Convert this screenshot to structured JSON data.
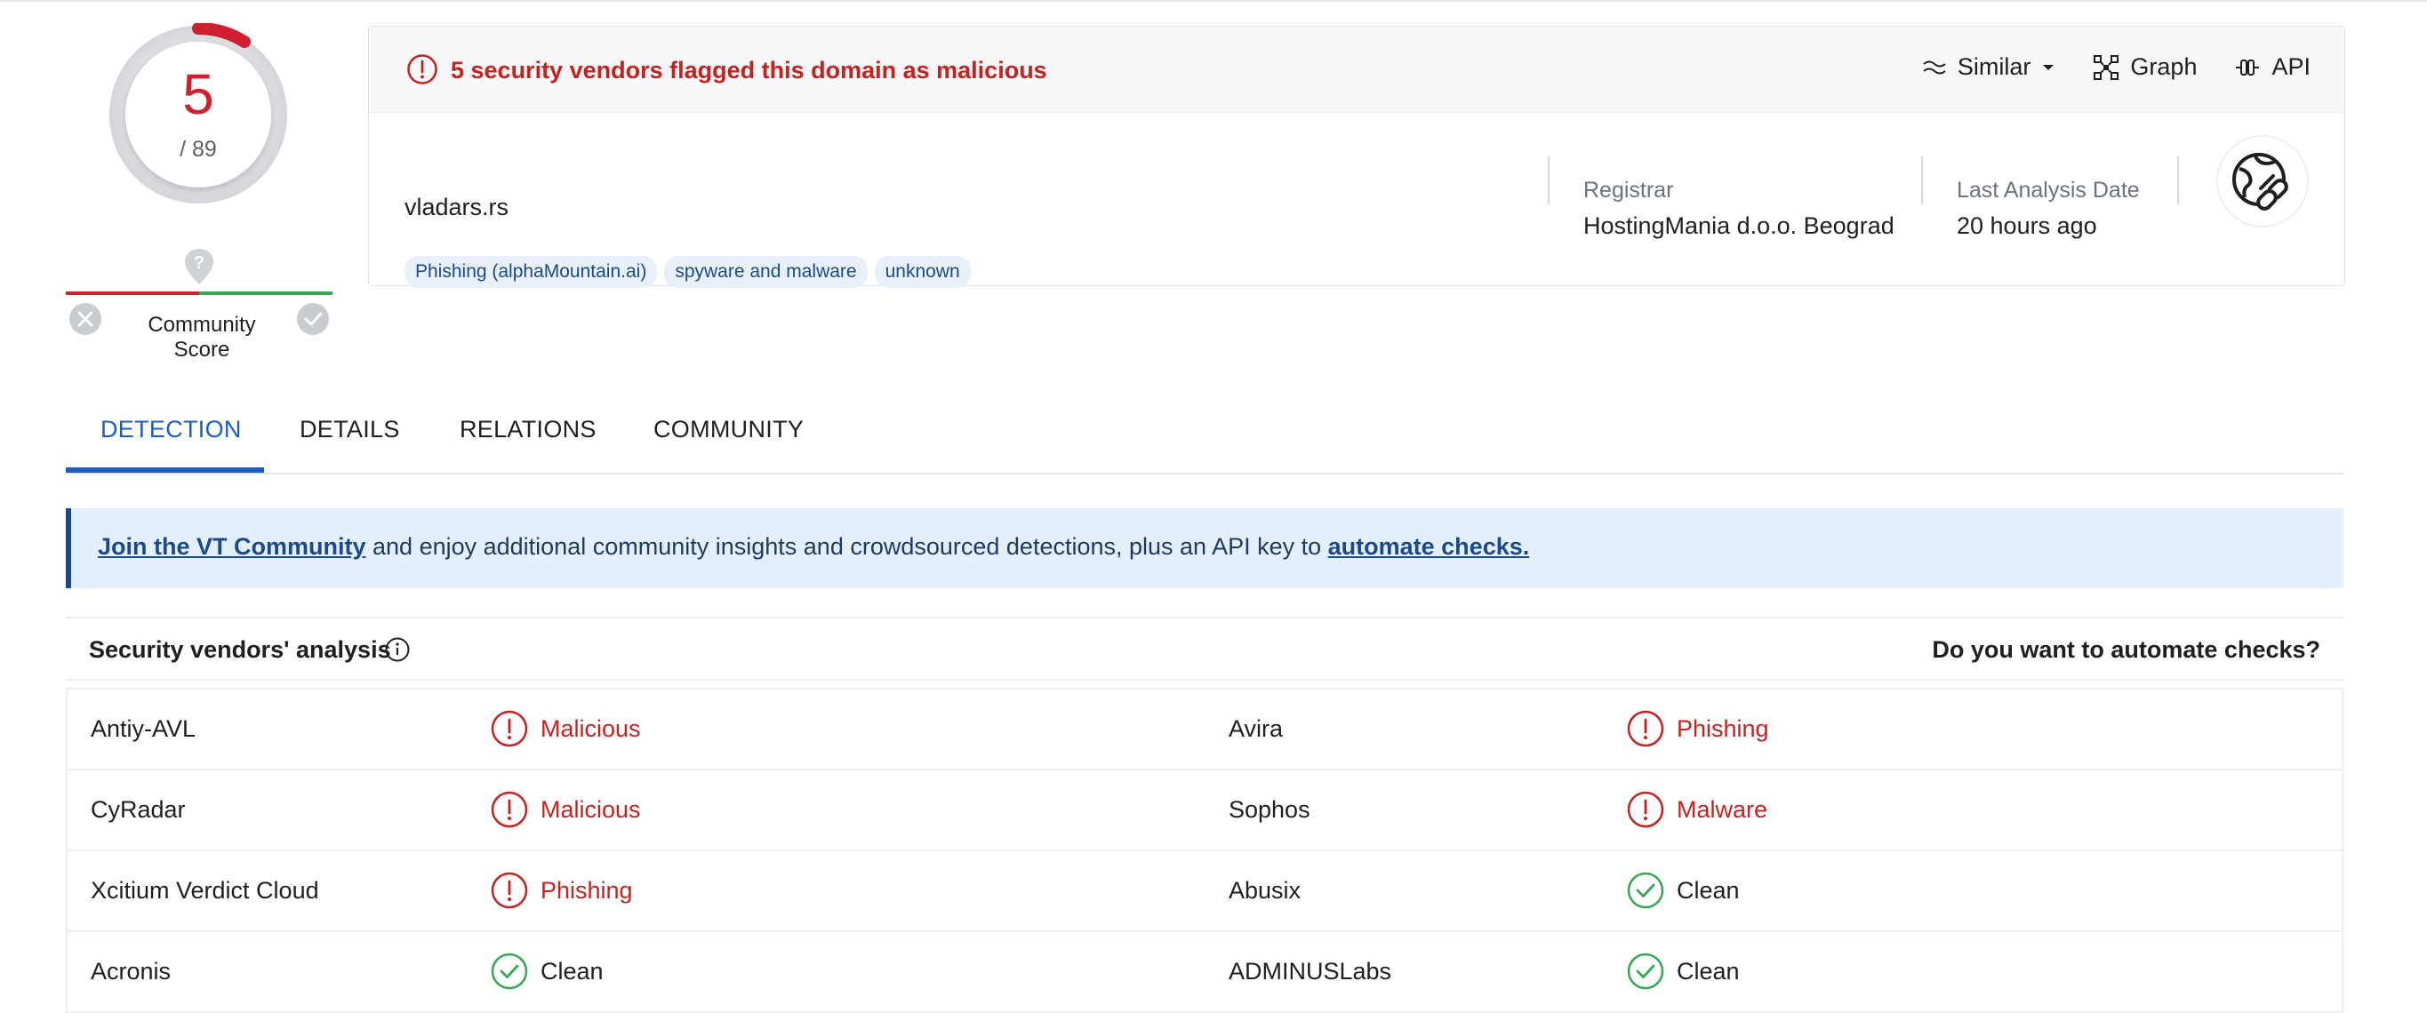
{
  "score": {
    "detected": "5",
    "total": "/ 89"
  },
  "community": {
    "label": "Community Score"
  },
  "alert": {
    "text": "5 security vendors flagged this domain as malicious"
  },
  "actions": [
    {
      "label": "Similar",
      "icon": "similar-icon"
    },
    {
      "label": "Graph",
      "icon": "graph-icon"
    },
    {
      "label": "API",
      "icon": "api-icon"
    }
  ],
  "domain": "vladars.rs",
  "tags": [
    "Phishing (alphaMountain.ai)",
    "spyware and malware",
    "unknown"
  ],
  "registrar": {
    "label": "Registrar",
    "value": "HostingMania d.o.o. Beograd"
  },
  "last_analysis": {
    "label": "Last Analysis Date",
    "value": "20 hours ago"
  },
  "tabs": [
    "DETECTION",
    "DETAILS",
    "RELATIONS",
    "COMMUNITY"
  ],
  "banner": {
    "link1": "Join the VT Community",
    "middle": " and enjoy additional community insights and crowdsourced detections, plus an API key to ",
    "link2": "automate checks."
  },
  "vendors": {
    "title": "Security vendors' analysis",
    "automate": "Do you want to automate checks?",
    "rows": [
      {
        "left_name": "Antiy-AVL",
        "left_verdict": "Malicious",
        "left_kind": "bad",
        "right_name": "Avira",
        "right_verdict": "Phishing",
        "right_kind": "bad"
      },
      {
        "left_name": "CyRadar",
        "left_verdict": "Malicious",
        "left_kind": "bad",
        "right_name": "Sophos",
        "right_verdict": "Malware",
        "right_kind": "bad"
      },
      {
        "left_name": "Xcitium Verdict Cloud",
        "left_verdict": "Phishing",
        "left_kind": "bad",
        "right_name": "Abusix",
        "right_verdict": "Clean",
        "right_kind": "clean"
      },
      {
        "left_name": "Acronis",
        "left_verdict": "Clean",
        "left_kind": "clean",
        "right_name": "ADMINUSLabs",
        "right_verdict": "Clean",
        "right_kind": "clean"
      }
    ]
  },
  "colors": {
    "malicious": "#c5221f",
    "clean": "#34a853",
    "accent": "#1a5cc8"
  }
}
